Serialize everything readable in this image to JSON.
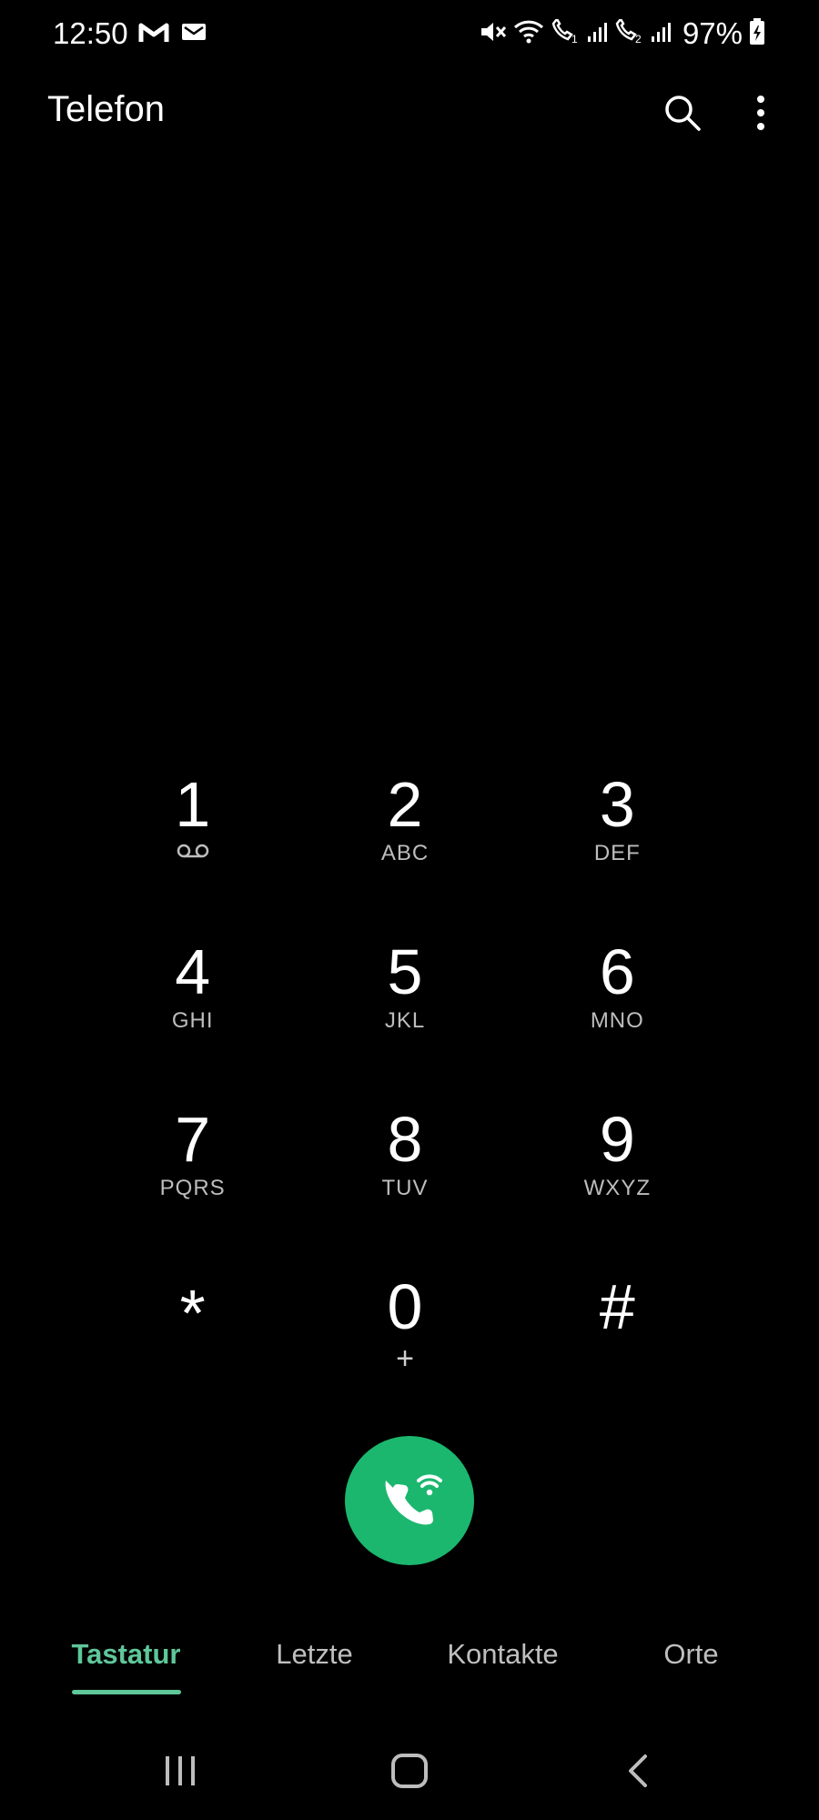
{
  "status_bar": {
    "time": "12:50",
    "battery_percent": "97%",
    "icons_left": [
      "gmail-icon",
      "mail-icon"
    ],
    "icons_right": [
      "mute-icon",
      "wifi-icon",
      "wifi-call-sim1-icon",
      "signal-icon",
      "wifi-call-sim2-icon",
      "signal-icon",
      "battery-charging-icon"
    ]
  },
  "app_bar": {
    "title": "Telefon",
    "actions": [
      "search-icon",
      "more-vert-icon"
    ]
  },
  "dialpad": {
    "keys": [
      {
        "digit": "1",
        "letters": "",
        "sub_icon": "voicemail-icon"
      },
      {
        "digit": "2",
        "letters": "ABC"
      },
      {
        "digit": "3",
        "letters": "DEF"
      },
      {
        "digit": "4",
        "letters": "GHI"
      },
      {
        "digit": "5",
        "letters": "JKL"
      },
      {
        "digit": "6",
        "letters": "MNO"
      },
      {
        "digit": "7",
        "letters": "PQRS"
      },
      {
        "digit": "8",
        "letters": "TUV"
      },
      {
        "digit": "9",
        "letters": "WXYZ"
      },
      {
        "digit": "*",
        "letters": ""
      },
      {
        "digit": "0",
        "letters": "+"
      },
      {
        "digit": "#",
        "letters": ""
      }
    ]
  },
  "call_button": {
    "icon": "wifi-call-icon",
    "color": "#1bb76e"
  },
  "tabs": {
    "items": [
      {
        "label": "Tastatur",
        "active": true
      },
      {
        "label": "Letzte",
        "active": false
      },
      {
        "label": "Kontakte",
        "active": false
      },
      {
        "label": "Orte",
        "active": false
      }
    ],
    "accent_color": "#5fc79a"
  },
  "nav_bar": {
    "buttons": [
      "recents-icon",
      "home-icon",
      "back-icon"
    ]
  }
}
